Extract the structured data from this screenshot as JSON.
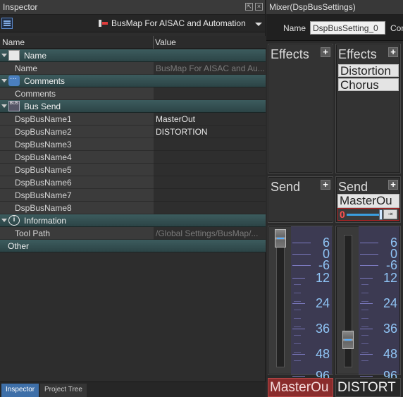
{
  "inspector": {
    "title": "Inspector",
    "target_name": "BusMap For AISAC and Automation",
    "columns": {
      "name": "Name",
      "value": "Value"
    },
    "categories": {
      "name_cat": "Name",
      "comments_cat": "Comments",
      "bus_send_cat": "Bus Send",
      "information_cat": "Information",
      "other_cat": "Other"
    },
    "props": {
      "name": {
        "label": "Name",
        "value": "BusMap For AISAC and Au..."
      },
      "comments": {
        "label": "Comments",
        "value": ""
      },
      "bus1": {
        "label": "DspBusName1",
        "value": "MasterOut"
      },
      "bus2": {
        "label": "DspBusName2",
        "value": "DISTORTION"
      },
      "bus3": {
        "label": "DspBusName3",
        "value": ""
      },
      "bus4": {
        "label": "DspBusName4",
        "value": ""
      },
      "bus5": {
        "label": "DspBusName5",
        "value": ""
      },
      "bus6": {
        "label": "DspBusName6",
        "value": ""
      },
      "bus7": {
        "label": "DspBusName7",
        "value": ""
      },
      "bus8": {
        "label": "DspBusName8",
        "value": ""
      },
      "toolpath": {
        "label": "Tool Path",
        "value": "/Global Settings/BusMap/..."
      }
    },
    "tabs": {
      "inspector": "Inspector",
      "project_tree": "Project Tree"
    },
    "icons": {
      "list_view": "list-view-icon",
      "busmap": "busmap-icon",
      "dropdown": "chevron-down-icon"
    }
  },
  "mixer": {
    "title": "Mixer(DspBusSettings)",
    "name_label": "Name",
    "name_value": "DspBusSetting_0",
    "con_label": "Con",
    "strips": [
      {
        "effects_title": "Effects",
        "effects": [],
        "send_title": "Send",
        "sends": [],
        "fader_level": 0.0,
        "bus_name": "MasterOu"
      },
      {
        "effects_title": "Effects",
        "effects": [
          "Distortion",
          "Chorus"
        ],
        "send_title": "Send",
        "send_item": "MasterOu",
        "send_value": "0",
        "fader_level": 0.0,
        "bus_name": "DISTORT"
      }
    ],
    "scale_labels": [
      "6",
      "0",
      "-6",
      "12",
      "24",
      "36",
      "48",
      "96"
    ],
    "plus_label": "+"
  }
}
